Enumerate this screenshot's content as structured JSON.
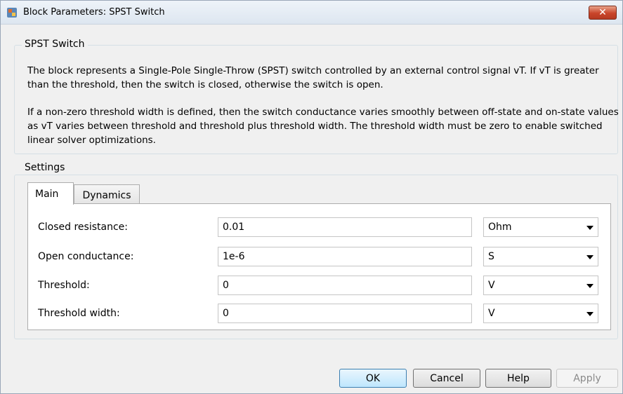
{
  "window": {
    "title": "Block Parameters: SPST Switch",
    "close_glyph": "✕"
  },
  "block": {
    "name": "SPST Switch",
    "description_1": "The block represents a Single-Pole Single-Throw (SPST) switch controlled by an external control signal vT. If vT is greater than the threshold, then the switch is closed, otherwise the switch is open.",
    "description_2": "If a non-zero threshold width is defined, then the switch conductance varies smoothly between off-state and on-state values as vT varies between threshold and threshold plus threshold width. The threshold width must be zero to enable switched linear solver optimizations."
  },
  "settings": {
    "legend": "Settings",
    "tabs": [
      {
        "label": "Main",
        "active": true
      },
      {
        "label": "Dynamics",
        "active": false
      }
    ],
    "params": [
      {
        "label": "Closed resistance:",
        "value": "0.01",
        "unit": "Ohm"
      },
      {
        "label": "Open conductance:",
        "value": "1e-6",
        "unit": "S"
      },
      {
        "label": "Threshold:",
        "value": "0",
        "unit": "V"
      },
      {
        "label": "Threshold width:",
        "value": "0",
        "unit": "V"
      }
    ]
  },
  "buttons": {
    "ok": "OK",
    "cancel": "Cancel",
    "help": "Help",
    "apply": "Apply"
  },
  "icons": {
    "app": "block-parameters-icon",
    "close": "close-icon",
    "dropdown": "chevron-down-icon"
  }
}
